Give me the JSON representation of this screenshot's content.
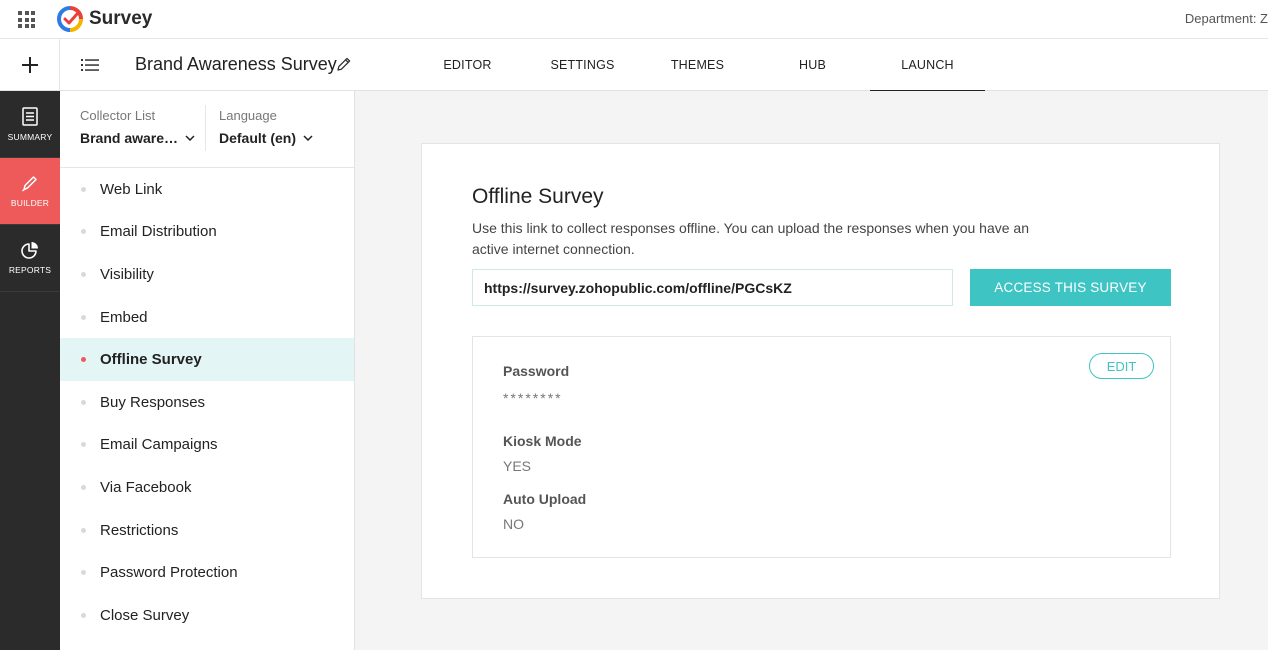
{
  "app": {
    "name": "Survey",
    "department_label": "Department: Z"
  },
  "header": {
    "survey_title": "Brand Awareness Survey",
    "tabs": [
      {
        "label": "EDITOR"
      },
      {
        "label": "SETTINGS"
      },
      {
        "label": "THEMES"
      },
      {
        "label": "HUB"
      },
      {
        "label": "LAUNCH",
        "active": true
      }
    ]
  },
  "leftnav": {
    "items": [
      {
        "label": "SUMMARY",
        "icon": "document-icon"
      },
      {
        "label": "BUILDER",
        "icon": "pencil-icon",
        "active": true
      },
      {
        "label": "REPORTS",
        "icon": "pie-chart-icon"
      }
    ]
  },
  "collector": {
    "list_caption": "Collector List",
    "list_value": "Brand aware…",
    "language_caption": "Language",
    "language_value": "Default (en)",
    "menu": [
      {
        "label": "Web Link"
      },
      {
        "label": "Email Distribution"
      },
      {
        "label": "Visibility"
      },
      {
        "label": "Embed"
      },
      {
        "label": "Offline Survey",
        "active": true
      },
      {
        "label": "Buy Responses"
      },
      {
        "label": "Email Campaigns"
      },
      {
        "label": "Via Facebook"
      },
      {
        "label": "Restrictions"
      },
      {
        "label": "Password Protection"
      },
      {
        "label": "Close Survey"
      }
    ]
  },
  "offline": {
    "title": "Offline Survey",
    "description": "Use this link to collect responses offline. You can upload the responses when you have an active internet connection.",
    "url": "https://survey.zohopublic.com/offline/PGCsKZ",
    "access_button": "ACCESS THIS SURVEY",
    "edit_button": "EDIT",
    "password_label": "Password",
    "password_value": "********",
    "kiosk_label": "Kiosk Mode",
    "kiosk_value": "YES",
    "upload_label": "Auto Upload",
    "upload_value": "NO"
  },
  "colors": {
    "accent": "#3ec4c3",
    "builder_active": "#ee5a5a",
    "nav_bg": "#2b2b2b",
    "active_row": "#e3f6f5"
  }
}
